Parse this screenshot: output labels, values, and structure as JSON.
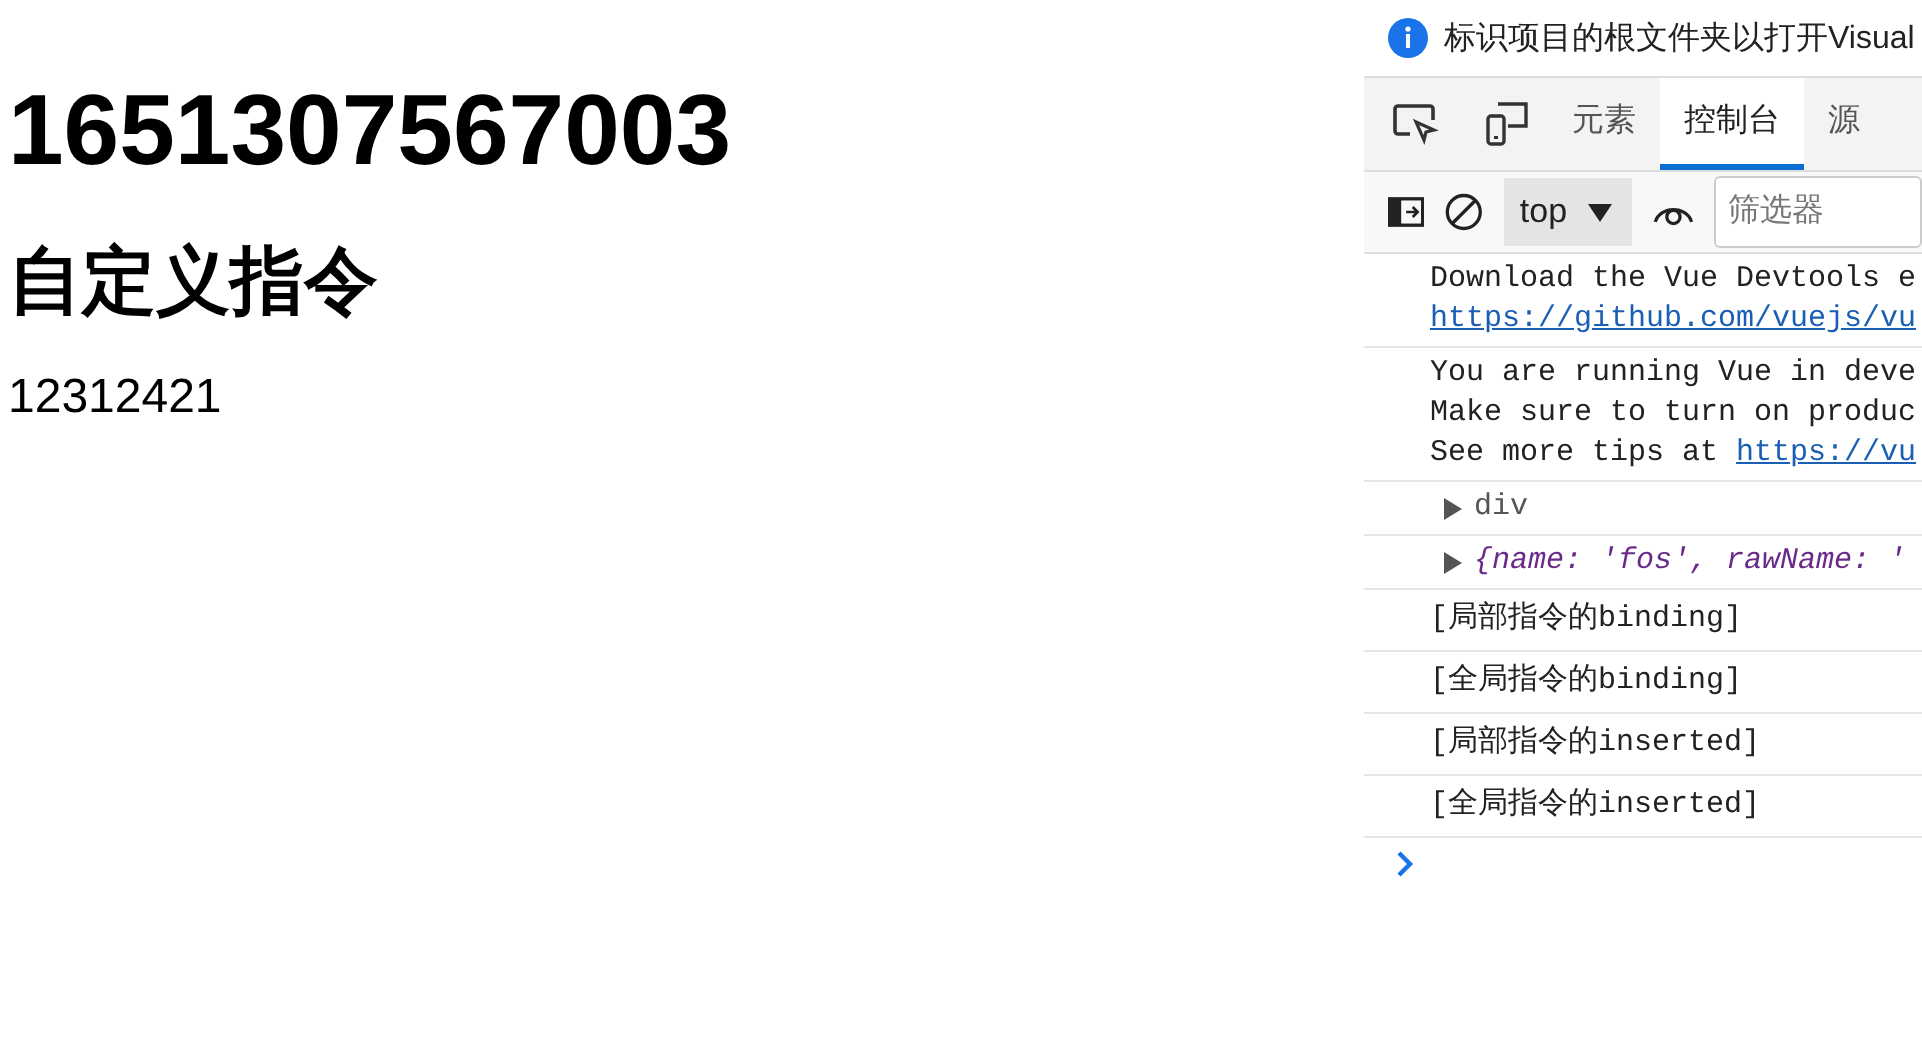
{
  "page": {
    "timestamp": "1651307567003",
    "heading": "自定义指令",
    "text": "12312421"
  },
  "devtools": {
    "info_bar": "标识项目的根文件夹以打开Visual",
    "tabs": [
      {
        "label": "元素",
        "selected": false
      },
      {
        "label": "控制台",
        "selected": true
      },
      {
        "label": "源",
        "selected": false
      }
    ],
    "toolbar": {
      "context": "top",
      "filter_placeholder": "筛选器"
    },
    "console": [
      {
        "kind": "log",
        "lines": [
          {
            "text": "Download the Vue Devtools e"
          },
          {
            "link": "https://github.com/vuejs/vu"
          }
        ]
      },
      {
        "kind": "log",
        "lines": [
          {
            "text": "You are running Vue in deve"
          },
          {
            "text": "Make sure to turn on produc"
          },
          {
            "text": "See more tips at ",
            "link": "https://vu"
          }
        ]
      },
      {
        "kind": "element",
        "text": "div"
      },
      {
        "kind": "object",
        "text": "{name: 'fos', rawName: '"
      },
      {
        "kind": "plain",
        "text": "[局部指令的binding]"
      },
      {
        "kind": "plain",
        "text": "[全局指令的binding]"
      },
      {
        "kind": "plain",
        "text": "[局部指令的inserted]"
      },
      {
        "kind": "plain",
        "text": "[全局指令的inserted]"
      }
    ]
  }
}
